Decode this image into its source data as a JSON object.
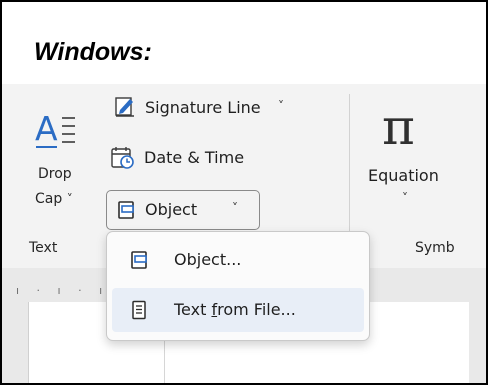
{
  "heading": "Windows:",
  "ribbon": {
    "drop_cap": {
      "line1": "Drop",
      "line2": "Cap",
      "caret": "˅"
    },
    "signature_line": {
      "label": "Signature Line",
      "caret": "˅"
    },
    "date_time": {
      "label": "Date & Time"
    },
    "object_button": {
      "label": "Object",
      "caret": "˅"
    },
    "equation": {
      "label": "Equation",
      "caret": "˅",
      "glyph": "π"
    },
    "groups": {
      "text": "Text",
      "symbols": "Symb"
    }
  },
  "menu": {
    "items": [
      {
        "label": "Object...",
        "icon": "object-icon"
      },
      {
        "pre": "Text ",
        "accel": "f",
        "post": "rom File...",
        "icon": "text-file-icon",
        "highlighted": true
      }
    ]
  },
  "ruler": {
    "ticks": "ı · ı · ı"
  },
  "colors": {
    "accent": "#2b6cc4",
    "menu_highlight": "#e8eef7",
    "ribbon_bg": "#f3f3f3"
  }
}
